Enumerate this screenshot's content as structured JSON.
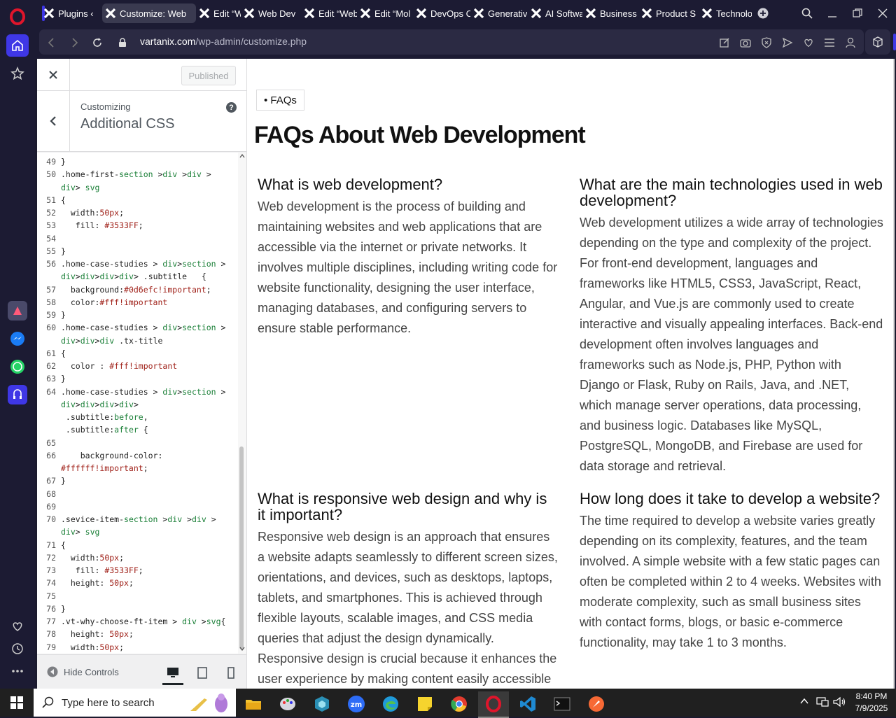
{
  "browser": {
    "tabs": [
      {
        "label": "Plugins ‹"
      },
      {
        "label": "Customize: Web"
      },
      {
        "label": "Edit “Web"
      },
      {
        "label": "Web Dev"
      },
      {
        "label": "Edit “Web"
      },
      {
        "label": "Edit “Mol"
      },
      {
        "label": "DevOps C"
      },
      {
        "label": "Generativ"
      },
      {
        "label": "AI Softwa"
      },
      {
        "label": "Business"
      },
      {
        "label": "Product S"
      },
      {
        "label": "Technolo"
      }
    ],
    "url_host": "vartanix.com",
    "url_path": "/wp-admin/customize.php"
  },
  "customizer": {
    "published_label": "Published",
    "customizing_label": "Customizing",
    "section_title": "Additional CSS",
    "help_glyph": "?",
    "hide_controls_label": "Hide Controls"
  },
  "code_lines": [
    {
      "n": "49",
      "t": "}"
    },
    {
      "n": "50",
      "t": ".home-first-section >div >div >"
    },
    {
      "n": "",
      "t": "div> svg"
    },
    {
      "n": "51",
      "t": "{"
    },
    {
      "n": "52",
      "t": "  width:50px;"
    },
    {
      "n": "53",
      "t": "   fill: #3533FF;"
    },
    {
      "n": "54",
      "t": ""
    },
    {
      "n": "55",
      "t": "}"
    },
    {
      "n": "56",
      "t": ".home-case-studies > div>section >"
    },
    {
      "n": "",
      "t": "div>div>div>div> .subtitle   {"
    },
    {
      "n": "57",
      "t": "  background:#0d6efc!important;"
    },
    {
      "n": "58",
      "t": "  color:#fff!important"
    },
    {
      "n": "59",
      "t": "}"
    },
    {
      "n": "60",
      "t": ".home-case-studies > div>section >"
    },
    {
      "n": "",
      "t": "div>div>div .tx-title"
    },
    {
      "n": "61",
      "t": "{"
    },
    {
      "n": "62",
      "t": "  color : #fff!important"
    },
    {
      "n": "63",
      "t": "}"
    },
    {
      "n": "64",
      "t": ".home-case-studies > div>section >"
    },
    {
      "n": "",
      "t": "div>div>div>div>"
    },
    {
      "n": "",
      "t": " .subtitle:before,"
    },
    {
      "n": "",
      "t": " .subtitle:after {"
    },
    {
      "n": "65",
      "t": ""
    },
    {
      "n": "66",
      "t": "    background-color:"
    },
    {
      "n": "",
      "t": "#ffffff!important;"
    },
    {
      "n": "67",
      "t": "}"
    },
    {
      "n": "68",
      "t": ""
    },
    {
      "n": "69",
      "t": ""
    },
    {
      "n": "70",
      "t": ".sevice-item-section >div >div >"
    },
    {
      "n": "",
      "t": "div> svg"
    },
    {
      "n": "71",
      "t": "{"
    },
    {
      "n": "72",
      "t": "  width:50px;"
    },
    {
      "n": "73",
      "t": "   fill: #3533FF;"
    },
    {
      "n": "74",
      "t": "  height: 50px;"
    },
    {
      "n": "75",
      "t": ""
    },
    {
      "n": "76",
      "t": "}"
    },
    {
      "n": "77",
      "t": ".vt-why-choose-ft-item > div >svg{"
    },
    {
      "n": "78",
      "t": "  height: 50px;"
    },
    {
      "n": "79",
      "t": "  width:50px;"
    }
  ],
  "preview": {
    "breadcrumb": "• FAQs",
    "heading": "FAQs About Web Development",
    "faqs": [
      {
        "q": "What is web development?",
        "a": "Web development is the process of building and maintaining websites and web applications that are accessible via the internet or private networks. It involves multiple disciplines, including writing code for website functionality, designing the user interface, managing databases, and configuring servers to ensure stable performance."
      },
      {
        "q": "What are the main technologies used in web development?",
        "a": "Web development utilizes a wide array of technologies depending on the type and complexity of the project. For front-end development, languages and frameworks like HTML5, CSS3, JavaScript, React, Angular, and Vue.js are commonly used to create interactive and visually appealing interfaces. Back-end development often involves languages and frameworks such as Node.js, PHP, Python with Django or Flask, Ruby on Rails, Java, and .NET, which manage server operations, data processing, and business logic. Databases like MySQL, PostgreSQL, MongoDB, and Firebase are used for data storage and retrieval."
      },
      {
        "q": "What is responsive web design and why is it important?",
        "a": "Responsive web design is an approach that ensures a website adapts seamlessly to different screen sizes, orientations, and devices, such as desktops, laptops, tablets, and smartphones. This is achieved through flexible layouts, scalable images, and CSS media queries that adjust the design dynamically. Responsive design is crucial because it enhances the user experience by making content easily accessible"
      },
      {
        "q": "How long does it take to develop a website?",
        "a": "The time required to develop a website varies greatly depending on its complexity, features, and the team involved. A simple website with a few static pages can often be completed within 2 to 4 weeks. Websites with moderate complexity, such as small business sites with contact forms, blogs, or basic e-commerce functionality, may take 1 to 3 months."
      }
    ]
  },
  "taskbar": {
    "search_placeholder": "Type here to search",
    "time": "8:40 PM",
    "date": "7/9/2025"
  },
  "colors": {
    "opera_red": "#e0152b",
    "accent_blue": "#3f37e6",
    "tab_x_color": "#ffffff"
  }
}
